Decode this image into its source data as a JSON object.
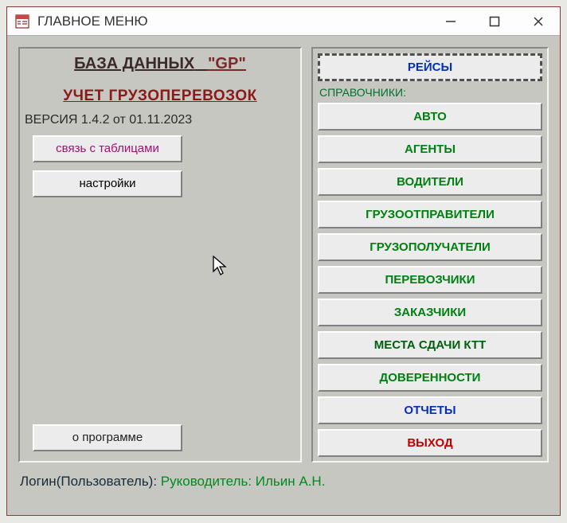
{
  "window": {
    "title": "ГЛАВНОЕ МЕНЮ"
  },
  "left": {
    "db_label": "БАЗА ДАННЫХ",
    "db_name": "\"GP\"",
    "subtitle": "УЧЕТ ГРУЗОПЕРЕВОЗОК",
    "version": "ВЕРСИЯ 1.4.2 от 01.11.2023",
    "link_tables": "связь с таблицами",
    "settings": "настройки",
    "about": "о программе"
  },
  "right": {
    "trips": "РЕЙСЫ",
    "section": "СПРАВОЧНИКИ:",
    "auto": "АВТО",
    "agents": "АГЕНТЫ",
    "drivers": "ВОДИТЕЛИ",
    "shippers": "ГРУЗООТПРАВИТЕЛИ",
    "consignees": "ГРУЗОПОЛУЧАТЕЛИ",
    "carriers": "ПЕРЕВОЗЧИКИ",
    "customers": "ЗАКАЗЧИКИ",
    "ktt": "МЕСТА СДАЧИ КТТ",
    "poa": "ДОВЕРЕННОСТИ",
    "reports": "ОТЧЕТЫ",
    "exit": "ВЫХОД"
  },
  "footer": {
    "login_label": "Логин(Пользователь): ",
    "user": "Руководитель: Ильин А.Н."
  }
}
